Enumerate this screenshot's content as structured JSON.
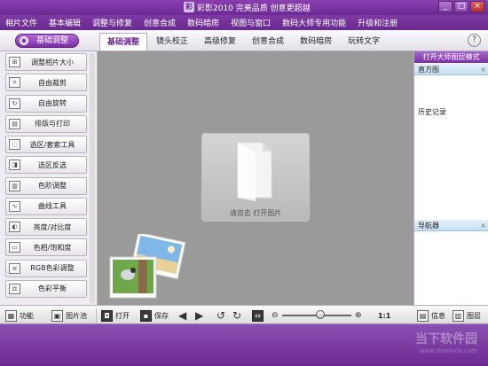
{
  "window": {
    "title": "彩影2010  完美品质  创意更超越",
    "minimize": "_",
    "maximize": "□",
    "close": "×"
  },
  "menu": [
    "相片文件",
    "基本编辑",
    "调整与修复",
    "创意合成",
    "数码暗房",
    "视图与窗口",
    "数码大师专用功能",
    "升级和注册"
  ],
  "toolbar": {
    "mode_button": "基础调整",
    "help": "?"
  },
  "tabs": [
    "基础调整",
    "镜头校正",
    "高级修复",
    "创意合成",
    "数码暗房",
    "玩转文字"
  ],
  "sidebar": [
    {
      "label": "调整相片大小",
      "icon": "resize-icon"
    },
    {
      "label": "自由裁剪",
      "icon": "crop-icon"
    },
    {
      "label": "自由旋转",
      "icon": "rotate-icon"
    },
    {
      "label": "排版与打印",
      "icon": "print-icon"
    },
    {
      "label": "选区/套索工具",
      "icon": "lasso-icon"
    },
    {
      "label": "选区反选",
      "icon": "invert-selection-icon"
    },
    {
      "label": "色阶调整",
      "icon": "levels-icon"
    },
    {
      "label": "曲线工具",
      "icon": "curves-icon"
    },
    {
      "label": "亮度/对比度",
      "icon": "brightness-icon"
    },
    {
      "label": "色相/饱和度",
      "icon": "hue-icon"
    },
    {
      "label": "RGB色彩调整",
      "icon": "rgb-icon"
    },
    {
      "label": "色彩平衡",
      "icon": "color-balance-icon"
    }
  ],
  "workspace": {
    "open_hint": "请双击  打开图片"
  },
  "right_panel": {
    "mode_button": "打开大师图层模式",
    "sections": [
      "直方图",
      "历史记录",
      "导航器"
    ],
    "close": "×"
  },
  "bottom": {
    "function": "功能",
    "picture_pool": "图片池",
    "open": "打开",
    "save": "保存",
    "zoom_ratio": "1:1",
    "info": "信息",
    "layers": "图层",
    "zoom_level": 0.55
  },
  "watermark": {
    "text": "当下软件园",
    "sub": "www.downxia.com"
  },
  "colors": {
    "brand": "#6b2a92",
    "accent": "#7a2ea6"
  }
}
